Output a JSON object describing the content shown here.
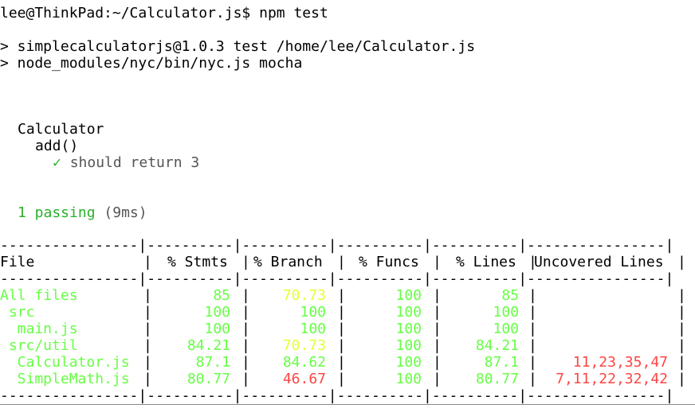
{
  "prompt": "lee@ThinkPad:~/Calculator.js$ npm test",
  "npm_line1": "> simplecalculatorjs@1.0.3 test /home/lee/Calculator.js",
  "npm_line2": "> node_modules/nyc/bin/nyc.js mocha",
  "suite": "Calculator",
  "test_group": "add()",
  "check": "✓",
  "test_name": "should return 3",
  "passing": "1 passing",
  "passing_time": "(9ms)",
  "dash_line": "----------------|----------|----------|----------|----------|----------------|",
  "table": {
    "headers": [
      "File",
      "% Stmts",
      "% Branch",
      "% Funcs",
      "% Lines",
      "Uncovered Lines"
    ],
    "rows": [
      {
        "file": "All files",
        "stmts": "85",
        "branch": "70.73",
        "funcs": "100",
        "lines": "85",
        "uncovered": "",
        "colors": {
          "file": "g",
          "stmts": "g",
          "branch": "y",
          "funcs": "g",
          "lines": "g",
          "uncovered": "red"
        }
      },
      {
        "file": " src",
        "stmts": "100",
        "branch": "100",
        "funcs": "100",
        "lines": "100",
        "uncovered": "",
        "colors": {
          "file": "g",
          "stmts": "g",
          "branch": "g",
          "funcs": "g",
          "lines": "g",
          "uncovered": "red"
        }
      },
      {
        "file": "  main.js",
        "stmts": "100",
        "branch": "100",
        "funcs": "100",
        "lines": "100",
        "uncovered": "",
        "colors": {
          "file": "g",
          "stmts": "g",
          "branch": "g",
          "funcs": "g",
          "lines": "g",
          "uncovered": "red"
        }
      },
      {
        "file": " src/util",
        "stmts": "84.21",
        "branch": "70.73",
        "funcs": "100",
        "lines": "84.21",
        "uncovered": "",
        "colors": {
          "file": "g",
          "stmts": "g",
          "branch": "y",
          "funcs": "g",
          "lines": "g",
          "uncovered": "red"
        }
      },
      {
        "file": "  Calculator.js",
        "stmts": "87.1",
        "branch": "84.62",
        "funcs": "100",
        "lines": "87.1",
        "uncovered": "11,23,35,47",
        "colors": {
          "file": "g",
          "stmts": "g",
          "branch": "g",
          "funcs": "g",
          "lines": "g",
          "uncovered": "red"
        }
      },
      {
        "file": "  SimpleMath.js",
        "stmts": "80.77",
        "branch": "46.67",
        "funcs": "100",
        "lines": "80.77",
        "uncovered": "7,11,22,32,42",
        "colors": {
          "file": "g",
          "stmts": "g",
          "branch": "red",
          "funcs": "g",
          "lines": "g",
          "uncovered": "red"
        }
      }
    ]
  },
  "colors": {
    "green": "#66ff44",
    "yellow": "#e6ff33",
    "red": "#ff4444",
    "pass_green": "#2ab02a"
  }
}
